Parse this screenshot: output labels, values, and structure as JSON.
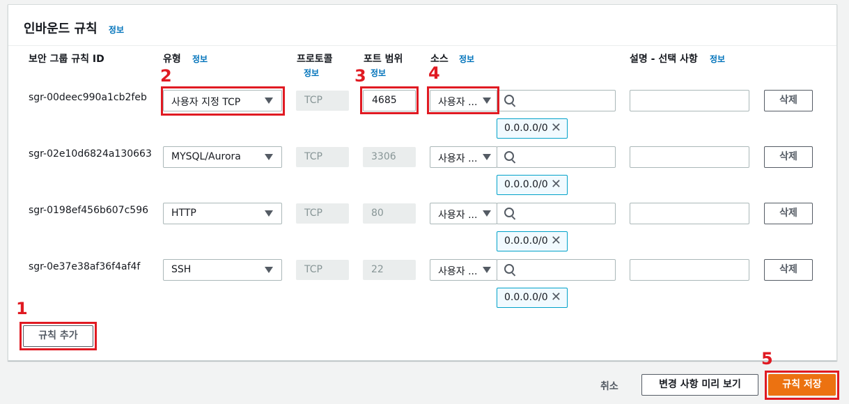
{
  "panel": {
    "title": "인바운드 규칙",
    "info": "정보"
  },
  "headers": {
    "rule_id": "보안 그룹 규칙 ID",
    "type": "유형",
    "type_info": "정보",
    "protocol": "프로토콜",
    "protocol_info": "정보",
    "port": "포트 범위",
    "port_info": "정보",
    "source": "소스",
    "source_info": "정보",
    "desc": "설명 - 선택 사항",
    "desc_info": "정보"
  },
  "rules": [
    {
      "id": "sgr-00deec990a1cb2feb",
      "type": "사용자 지정 TCP",
      "protocol": "TCP",
      "port": "4685",
      "source": "사용자 ...",
      "cidr": "0.0.0.0/0",
      "delete": "삭제"
    },
    {
      "id": "sgr-02e10d6824a130663",
      "type": "MYSQL/Aurora",
      "protocol": "TCP",
      "port": "3306",
      "source": "사용자 ...",
      "cidr": "0.0.0.0/0",
      "delete": "삭제"
    },
    {
      "id": "sgr-0198ef456b607c596",
      "type": "HTTP",
      "protocol": "TCP",
      "port": "80",
      "source": "사용자 ...",
      "cidr": "0.0.0.0/0",
      "delete": "삭제"
    },
    {
      "id": "sgr-0e37e38af36f4af4f",
      "type": "SSH",
      "protocol": "TCP",
      "port": "22",
      "source": "사용자 ...",
      "cidr": "0.0.0.0/0",
      "delete": "삭제"
    }
  ],
  "add_rule": "규칙 추가",
  "footer": {
    "cancel": "취소",
    "preview": "변경 사항 미리 보기",
    "save": "규칙 저장"
  },
  "annotations": [
    "1",
    "2",
    "3",
    "4",
    "5"
  ],
  "colors": {
    "primary": "#ec7211",
    "highlight": "#e01a22",
    "link": "#0073bb"
  }
}
